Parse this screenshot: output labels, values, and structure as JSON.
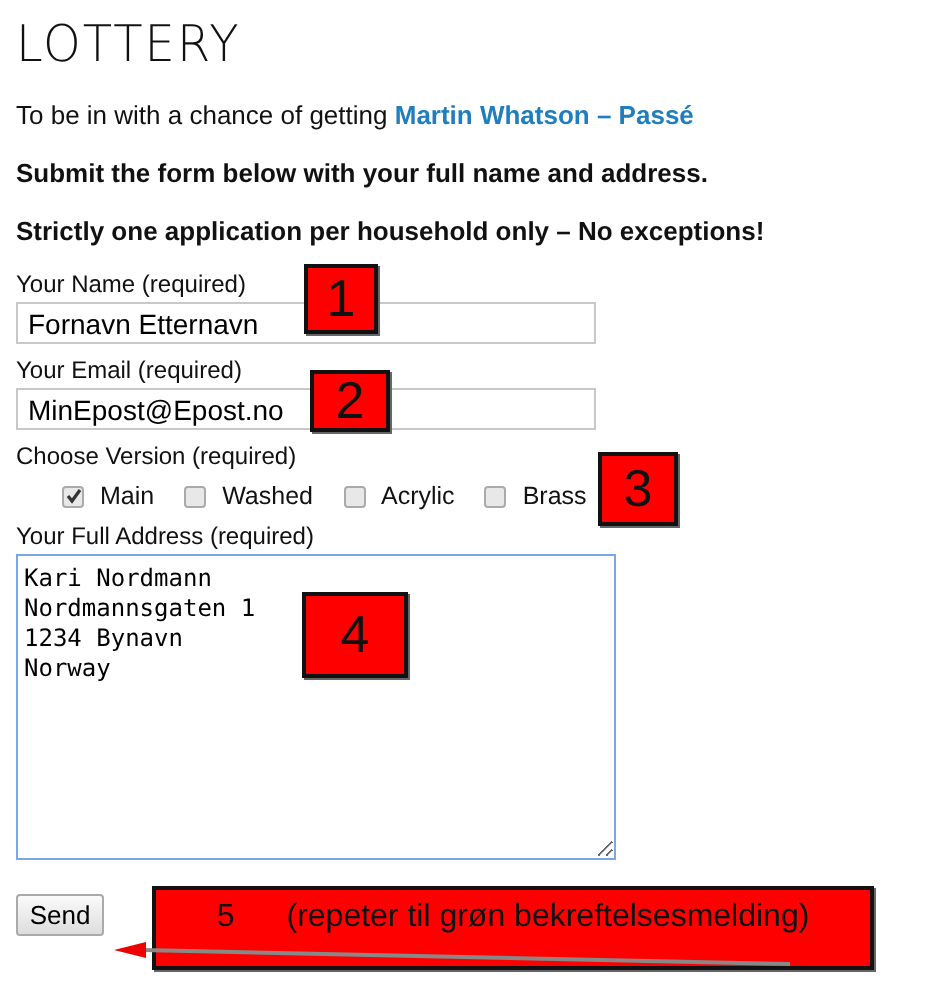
{
  "title": "LOTTERY",
  "intro": {
    "text": "To be in with a chance of getting",
    "link": "Martin Whatson – Passé"
  },
  "notes": [
    "Submit the form below with your full name and address.",
    "Strictly one application per household only – No exceptions!"
  ],
  "fields": [
    {
      "kind": "text",
      "label": "Your Name (required)",
      "value": "Fornavn Etternavn"
    },
    {
      "kind": "text",
      "label": "Your Email (required)",
      "value": "MinEpost@Epost.no"
    },
    {
      "kind": "checkboxes",
      "label": "Choose Version (required)",
      "options": [
        {
          "label": "Main",
          "checked": true
        },
        {
          "label": "Washed",
          "checked": false
        },
        {
          "label": "Acrylic",
          "checked": false
        },
        {
          "label": "Brass",
          "checked": false
        }
      ]
    },
    {
      "kind": "textarea",
      "label": "Your Full Address (required)",
      "value": "Kari Nordmann\nNordmannsgaten 1\n1234 Bynavn\nNorway"
    }
  ],
  "submit": "Send",
  "callouts": [
    {
      "number": "1"
    },
    {
      "number": "2"
    },
    {
      "number": "3"
    },
    {
      "number": "4"
    },
    {
      "number": "5",
      "text": "(repeter til grøn bekreftelsesmelding)"
    }
  ]
}
